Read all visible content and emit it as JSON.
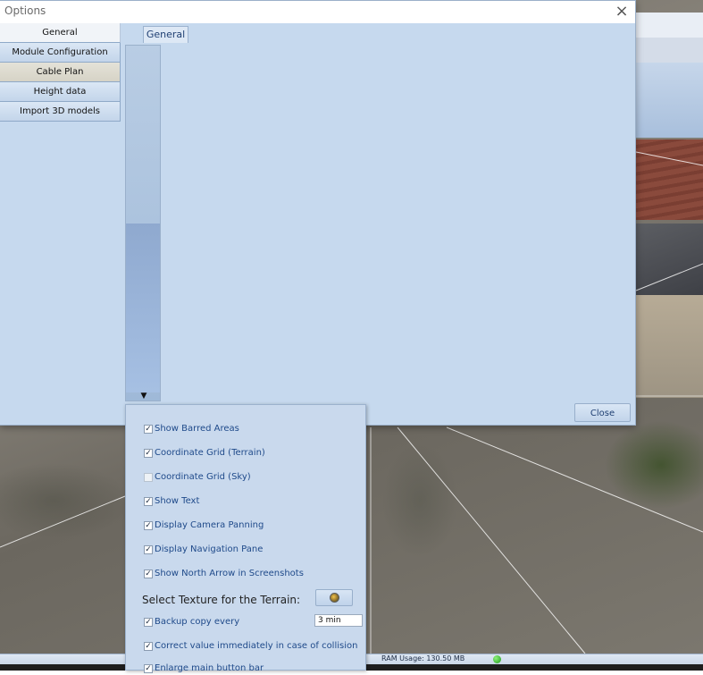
{
  "dialog": {
    "title": "Options",
    "close_label": "Close"
  },
  "nav": {
    "items": [
      {
        "label": "General"
      },
      {
        "label": "Module Configuration"
      },
      {
        "label": "Cable Plan"
      },
      {
        "label": "Height data"
      },
      {
        "label": "Import 3D models"
      }
    ]
  },
  "tab": {
    "label": "General"
  },
  "panel": {
    "options": [
      {
        "label": "Show Barred Areas",
        "checked": true
      },
      {
        "label": "Coordinate Grid (Terrain)",
        "checked": true
      },
      {
        "label": "Coordinate Grid (Sky)",
        "checked": false
      },
      {
        "label": "Show Text",
        "checked": true
      },
      {
        "label": "Display Camera Panning",
        "checked": true
      },
      {
        "label": "Display Navigation Pane",
        "checked": true
      },
      {
        "label": "Show North Arrow in Screenshots",
        "checked": true
      }
    ],
    "terrain_label": "Select Texture for the Terrain:",
    "backup_label": "Backup copy every",
    "backup_checked": true,
    "backup_value": "3 min",
    "collision_label": "Correct value immediately in case of collision",
    "collision_checked": true,
    "enlarge_label": "Enlarge main button bar",
    "enlarge_checked": true
  },
  "status": {
    "ram_usage": "RAM Usage:  130.50 MB"
  },
  "icons": {
    "close": "close-icon",
    "dropdown_arrow": "triangle-down-icon",
    "terrain_texture": "globe-texture-icon",
    "status_led": "green-dot-icon"
  },
  "colors": {
    "dialog_bg": "#c6d9ee",
    "label_blue": "#1f4a8a",
    "led_green": "#1c9a1c"
  }
}
